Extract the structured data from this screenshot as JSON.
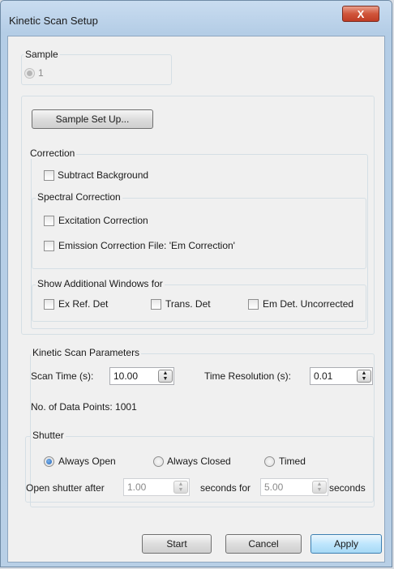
{
  "window": {
    "title": "Kinetic Scan Setup",
    "close_glyph": "X"
  },
  "sample": {
    "group_label": "Sample",
    "option_label": "1",
    "setup_button": "Sample Set Up..."
  },
  "correction": {
    "group_label": "Correction",
    "subtract_background": "Subtract Background",
    "spectral": {
      "group_label": "Spectral Correction",
      "excitation": "Excitation Correction",
      "emission": "Emission Correction File: 'Em Correction'"
    },
    "additional": {
      "group_label": "Show Additional Windows for",
      "ex_ref": "Ex Ref. Det",
      "trans": "Trans. Det",
      "em_uncorrected": "Em Det. Uncorrected"
    }
  },
  "kinetic": {
    "group_label": "Kinetic Scan Parameters",
    "scan_time_label": "Scan Time (s):",
    "scan_time_value": "10.00",
    "time_resolution_label": "Time Resolution (s):",
    "time_resolution_value": "0.01",
    "data_points_label": "No. of Data Points: 1001"
  },
  "shutter": {
    "group_label": "Shutter",
    "always_open": "Always Open",
    "always_closed": "Always Closed",
    "timed": "Timed",
    "selected": "Always Open",
    "open_after_label": "Open shutter after",
    "open_after_value": "1.00",
    "seconds_for_label": "seconds for",
    "seconds_for_value": "5.00",
    "seconds_label": "seconds"
  },
  "buttons": {
    "start": "Start",
    "cancel": "Cancel",
    "apply": "Apply"
  },
  "icons": {
    "spin_up": "▲",
    "spin_down": "▼"
  }
}
